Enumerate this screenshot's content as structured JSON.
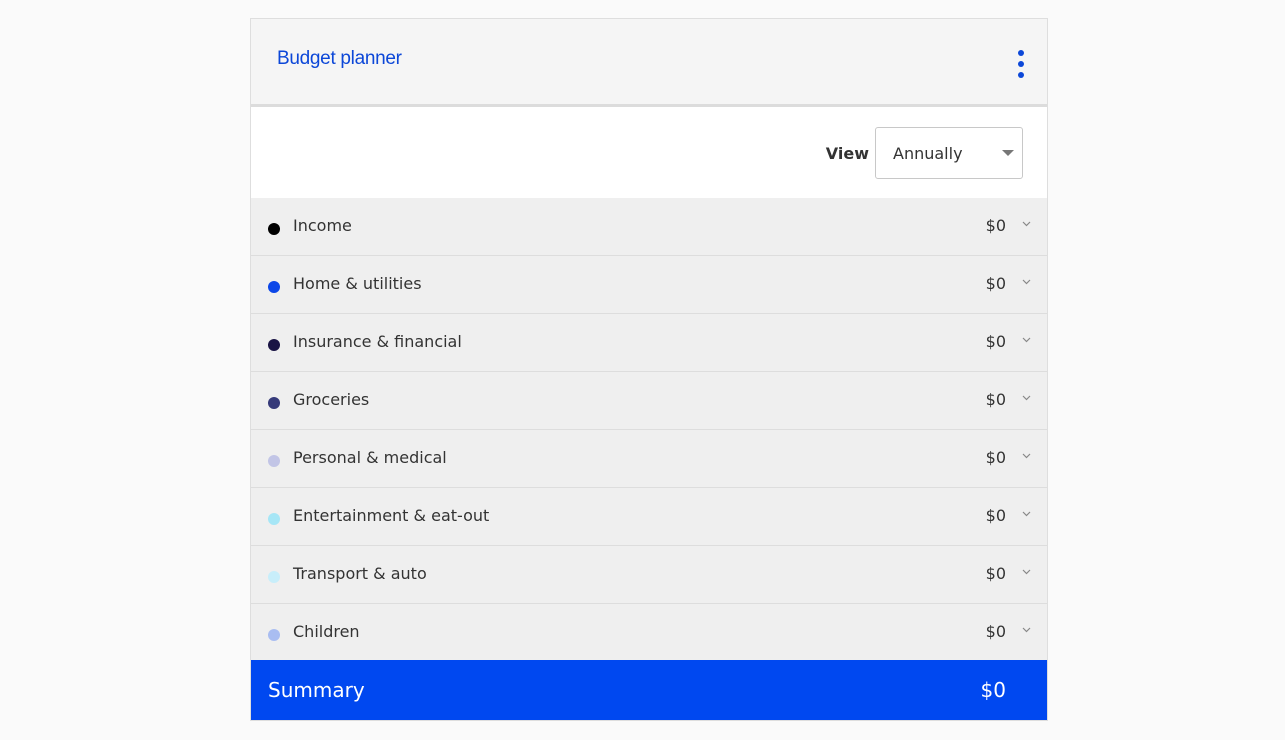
{
  "header": {
    "title": "Budget planner",
    "menu_icon": "kebab-menu-icon"
  },
  "view": {
    "label": "View",
    "selected": "Annually"
  },
  "categories": [
    {
      "label": "Income",
      "amount": "$0",
      "color": "#000000"
    },
    {
      "label": "Home & utilities",
      "amount": "$0",
      "color": "#0c47e8"
    },
    {
      "label": "Insurance & financial",
      "amount": "$0",
      "color": "#1a1444"
    },
    {
      "label": "Groceries",
      "amount": "$0",
      "color": "#363a7a"
    },
    {
      "label": "Personal & medical",
      "amount": "$0",
      "color": "#c2c5e6"
    },
    {
      "label": "Entertainment & eat-out",
      "amount": "$0",
      "color": "#a6e6f6"
    },
    {
      "label": "Transport & auto",
      "amount": "$0",
      "color": "#c8eefa"
    },
    {
      "label": "Children",
      "amount": "$0",
      "color": "#a9bdf1"
    }
  ],
  "summary": {
    "label": "Summary",
    "amount": "$0"
  },
  "colors": {
    "accent": "#0c47d8",
    "summary_bg": "#0048f0"
  }
}
